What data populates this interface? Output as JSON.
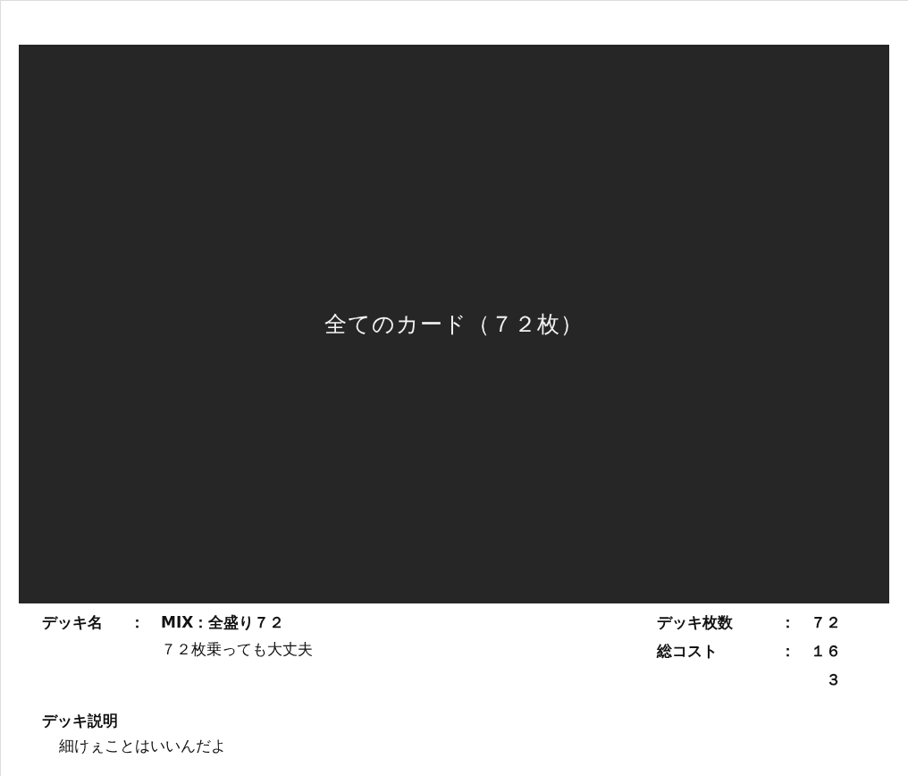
{
  "card_panel": {
    "title": "全てのカード（７２枚）"
  },
  "deck_name": {
    "label": "デッキ名",
    "separator": "：",
    "value": "MIX：全盛り７２",
    "subtitle": "７２枚乗っても大丈夫"
  },
  "stats": [
    {
      "label": "デッキ枚数",
      "separator": "：",
      "value": "７２"
    },
    {
      "label": "総コスト",
      "separator": "：",
      "value": "１６３"
    }
  ],
  "description": {
    "label": "デッキ説明",
    "text": "細けぇことはいいんだよ"
  }
}
